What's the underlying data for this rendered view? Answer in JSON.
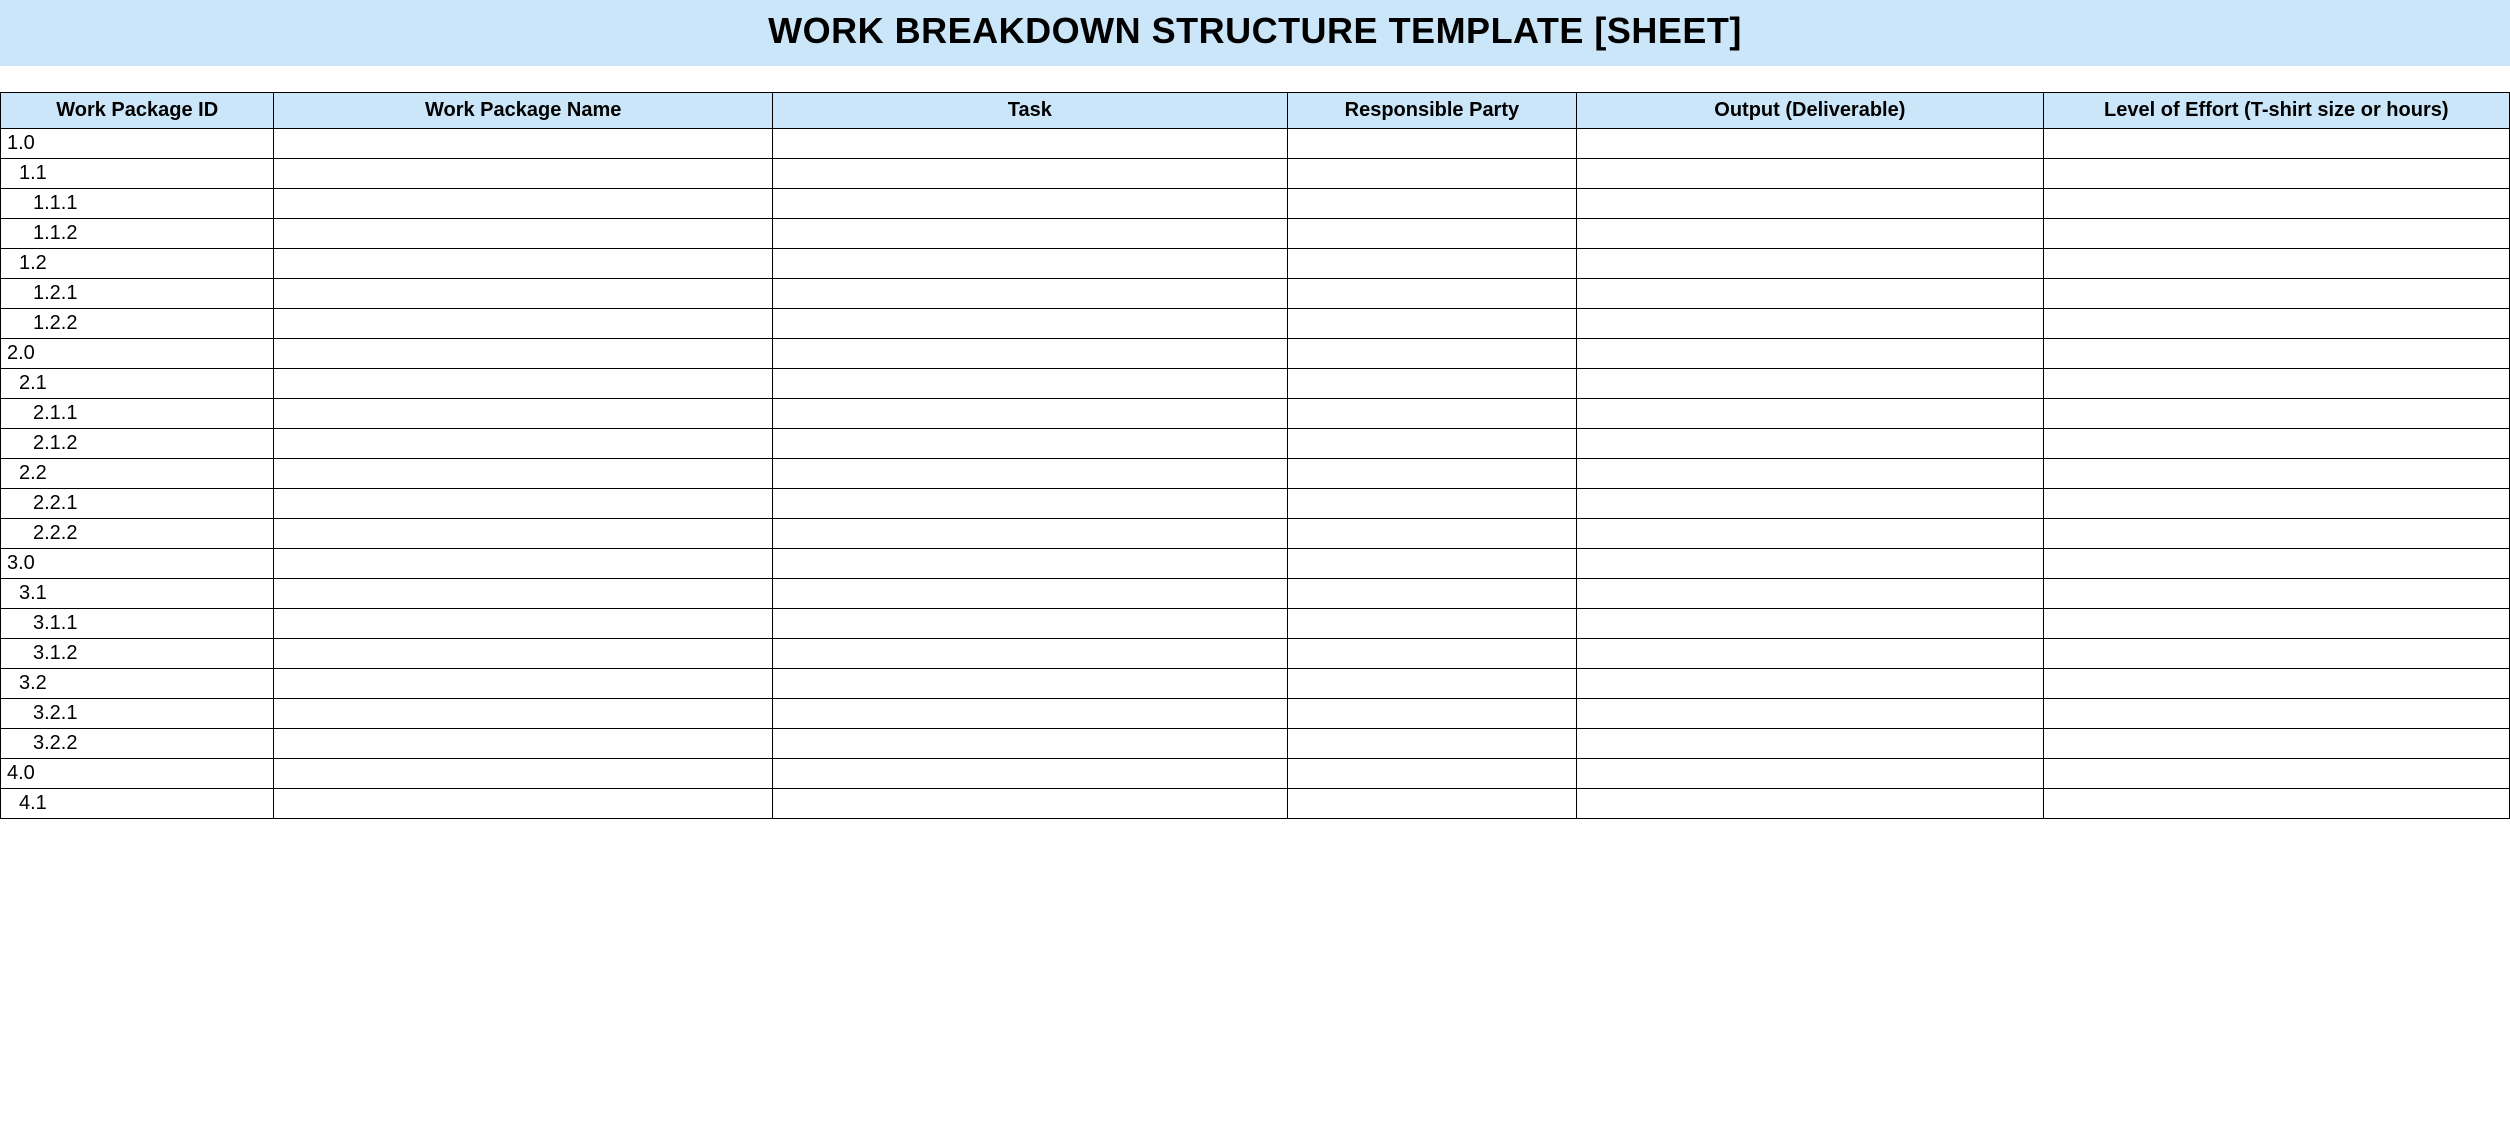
{
  "title": "WORK BREAKDOWN STRUCTURE TEMPLATE [SHEET]",
  "columns": [
    "Work Package ID",
    "Work Package Name",
    "Task",
    "Responsible Party",
    "Output (Deliverable)",
    "Level of Effort (T-shirt size or hours)"
  ],
  "rows": [
    {
      "id": "1.0",
      "indent": 0,
      "name": "",
      "task": "",
      "party": "",
      "output": "",
      "effort": ""
    },
    {
      "id": "1.1",
      "indent": 1,
      "name": "",
      "task": "",
      "party": "",
      "output": "",
      "effort": ""
    },
    {
      "id": "1.1.1",
      "indent": 2,
      "name": "",
      "task": "",
      "party": "",
      "output": "",
      "effort": ""
    },
    {
      "id": "1.1.2",
      "indent": 2,
      "name": "",
      "task": "",
      "party": "",
      "output": "",
      "effort": ""
    },
    {
      "id": "1.2",
      "indent": 1,
      "name": "",
      "task": "",
      "party": "",
      "output": "",
      "effort": ""
    },
    {
      "id": "1.2.1",
      "indent": 2,
      "name": "",
      "task": "",
      "party": "",
      "output": "",
      "effort": ""
    },
    {
      "id": "1.2.2",
      "indent": 2,
      "name": "",
      "task": "",
      "party": "",
      "output": "",
      "effort": ""
    },
    {
      "id": "2.0",
      "indent": 0,
      "name": "",
      "task": "",
      "party": "",
      "output": "",
      "effort": ""
    },
    {
      "id": "2.1",
      "indent": 1,
      "name": "",
      "task": "",
      "party": "",
      "output": "",
      "effort": ""
    },
    {
      "id": "2.1.1",
      "indent": 2,
      "name": "",
      "task": "",
      "party": "",
      "output": "",
      "effort": ""
    },
    {
      "id": "2.1.2",
      "indent": 2,
      "name": "",
      "task": "",
      "party": "",
      "output": "",
      "effort": ""
    },
    {
      "id": "2.2",
      "indent": 1,
      "name": "",
      "task": "",
      "party": "",
      "output": "",
      "effort": ""
    },
    {
      "id": "2.2.1",
      "indent": 2,
      "name": "",
      "task": "",
      "party": "",
      "output": "",
      "effort": ""
    },
    {
      "id": "2.2.2",
      "indent": 2,
      "name": "",
      "task": "",
      "party": "",
      "output": "",
      "effort": ""
    },
    {
      "id": "3.0",
      "indent": 0,
      "name": "",
      "task": "",
      "party": "",
      "output": "",
      "effort": ""
    },
    {
      "id": "3.1",
      "indent": 1,
      "name": "",
      "task": "",
      "party": "",
      "output": "",
      "effort": ""
    },
    {
      "id": "3.1.1",
      "indent": 2,
      "name": "",
      "task": "",
      "party": "",
      "output": "",
      "effort": ""
    },
    {
      "id": "3.1.2",
      "indent": 2,
      "name": "",
      "task": "",
      "party": "",
      "output": "",
      "effort": ""
    },
    {
      "id": "3.2",
      "indent": 1,
      "name": "",
      "task": "",
      "party": "",
      "output": "",
      "effort": ""
    },
    {
      "id": "3.2.1",
      "indent": 2,
      "name": "",
      "task": "",
      "party": "",
      "output": "",
      "effort": ""
    },
    {
      "id": "3.2.2",
      "indent": 2,
      "name": "",
      "task": "",
      "party": "",
      "output": "",
      "effort": ""
    },
    {
      "id": "4.0",
      "indent": 0,
      "name": "",
      "task": "",
      "party": "",
      "output": "",
      "effort": ""
    },
    {
      "id": "4.1",
      "indent": 1,
      "name": "",
      "task": "",
      "party": "",
      "output": "",
      "effort": ""
    }
  ]
}
